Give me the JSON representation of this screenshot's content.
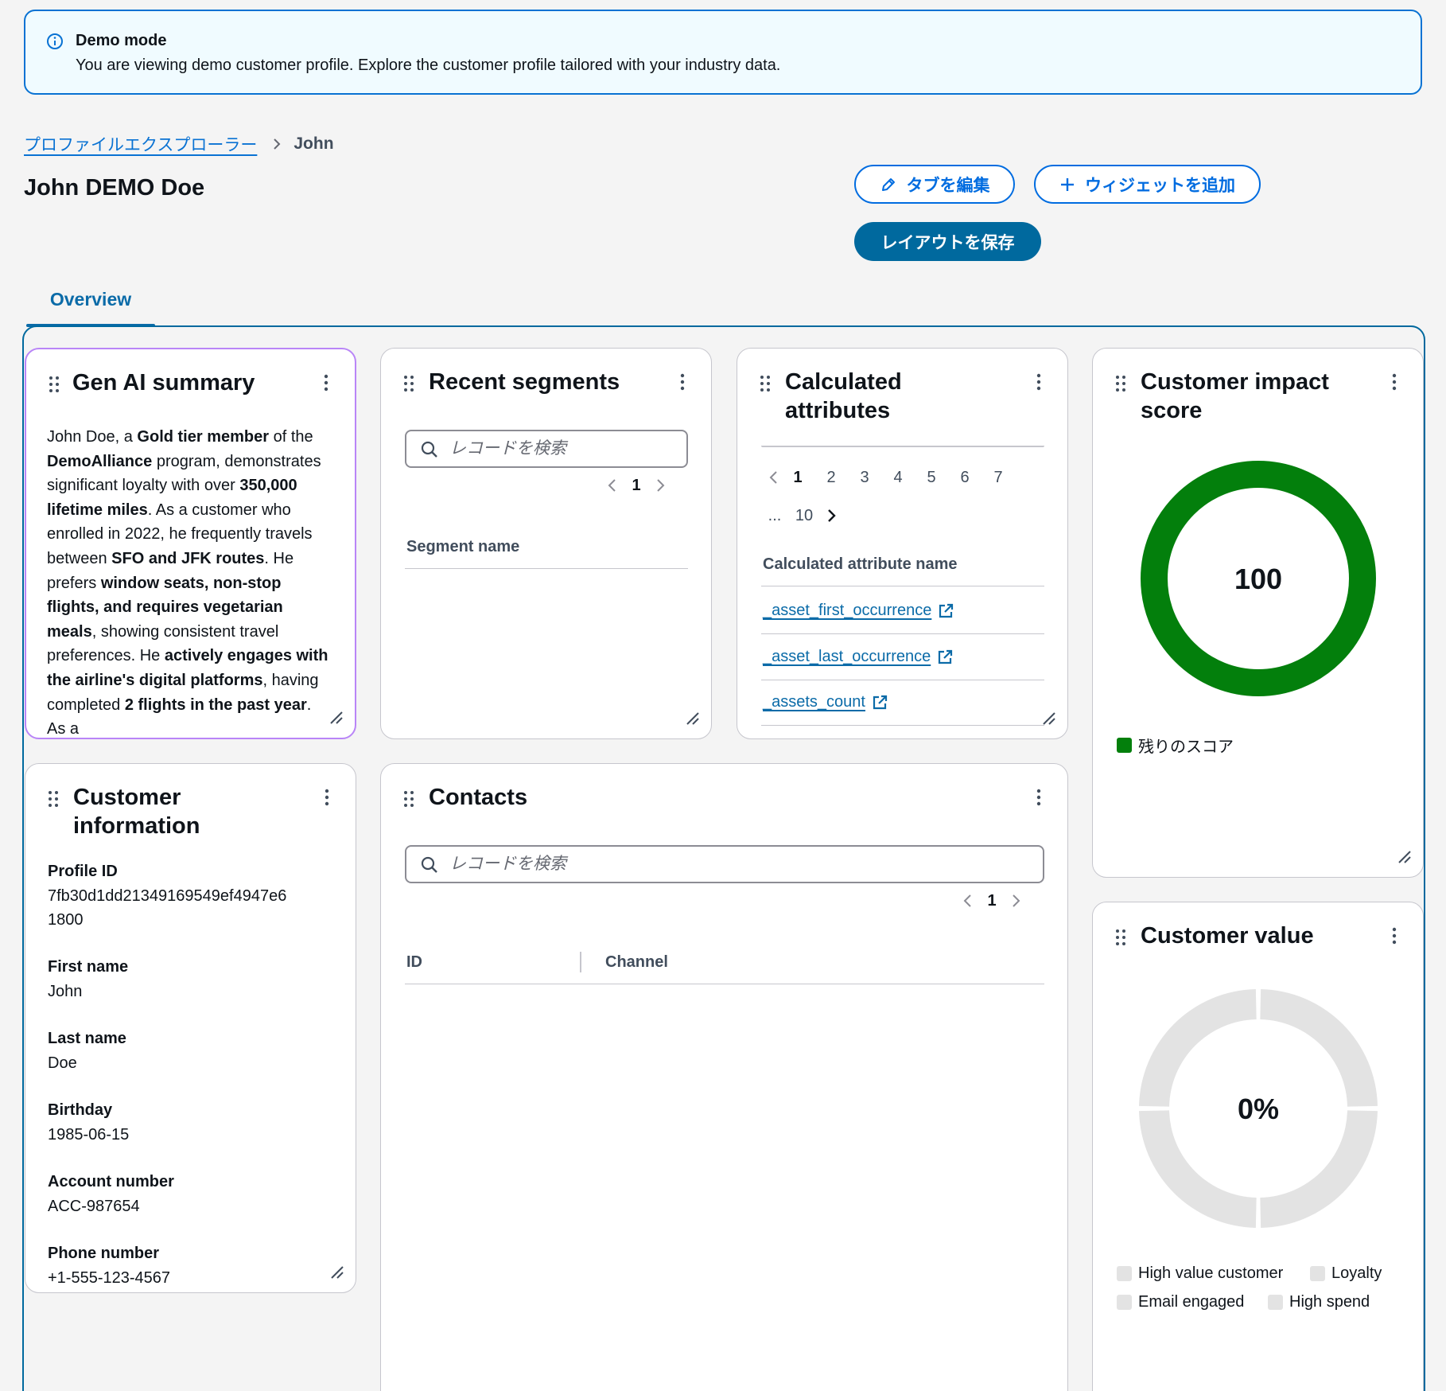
{
  "banner": {
    "icon": "info-circle-icon",
    "title": "Demo mode",
    "text": "You are viewing demo customer profile. Explore the customer profile tailored with your industry data."
  },
  "breadcrumb": {
    "parent": "プロファイルエクスプローラー",
    "current": "John"
  },
  "page_title": "John DEMO Doe",
  "actions": {
    "edit_tabs": "タブを編集",
    "add_widget": "ウィジェットを追加",
    "save_layout": "レイアウトを保存"
  },
  "tabs": [
    {
      "label": "Overview",
      "selected": true
    }
  ],
  "widgets": {
    "genai": {
      "title": "Gen AI summary",
      "summary": [
        {
          "text": "John Doe, a ",
          "bold": false
        },
        {
          "text": "Gold tier member",
          "bold": true
        },
        {
          "text": " of the ",
          "bold": false
        },
        {
          "text": "DemoAlliance",
          "bold": true
        },
        {
          "text": " program, demonstrates significant loyalty with over ",
          "bold": false
        },
        {
          "text": "350,000 lifetime miles",
          "bold": true
        },
        {
          "text": ". As a customer who enrolled in 2022, he frequently travels between ",
          "bold": false
        },
        {
          "text": "SFO and JFK routes",
          "bold": true
        },
        {
          "text": ". He prefers ",
          "bold": false
        },
        {
          "text": "window seats, non-stop flights, and requires vegetarian meals",
          "bold": true
        },
        {
          "text": ", showing consistent travel preferences. He ",
          "bold": false
        },
        {
          "text": "actively engages with the airline's digital platforms",
          "bold": true
        },
        {
          "text": ", having completed ",
          "bold": false
        },
        {
          "text": "2 flights in the past year",
          "bold": true
        },
        {
          "text": ". As a",
          "bold": false
        }
      ]
    },
    "segments": {
      "title": "Recent segments",
      "search_placeholder": "レコードを検索",
      "page": "1",
      "column": "Segment name"
    },
    "calculated": {
      "title": "Calculated attributes",
      "pages": [
        "1",
        "2",
        "3",
        "4",
        "5",
        "6",
        "7"
      ],
      "ellipsis": "...",
      "last_page": "10",
      "column": "Calculated attribute name",
      "rows": [
        "_asset_first_occurrence",
        "_asset_last_occurrence",
        "_assets_count"
      ]
    },
    "impact": {
      "title": "Customer impact score",
      "value": "100",
      "score": 100,
      "ring_color": "#037f0c",
      "legend": "残りのスコア"
    },
    "customer_info": {
      "title": "Customer information",
      "fields": [
        {
          "label": "Profile ID",
          "value": "7fb30d1dd21349169549ef4947e6 1800"
        },
        {
          "label": "First name",
          "value": "John"
        },
        {
          "label": "Last name",
          "value": "Doe"
        },
        {
          "label": "Birthday",
          "value": "1985-06-15"
        },
        {
          "label": "Account number",
          "value": "ACC-987654"
        },
        {
          "label": "Phone number",
          "value": "+1-555-123-4567"
        }
      ]
    },
    "contacts": {
      "title": "Contacts",
      "search_placeholder": "レコードを検索",
      "page": "1",
      "columns": [
        "ID",
        "Channel"
      ]
    },
    "customer_value": {
      "title": "Customer value",
      "value": "0%",
      "percent": 0,
      "empty_color": "#e3e3e3",
      "legend": [
        "High value customer",
        "Loyalty",
        "Email engaged",
        "High spend"
      ]
    }
  },
  "colors": {
    "accent": "#0b6ba8",
    "link": "#0972d3",
    "banner_border": "#0972d3",
    "success": "#037f0c"
  }
}
